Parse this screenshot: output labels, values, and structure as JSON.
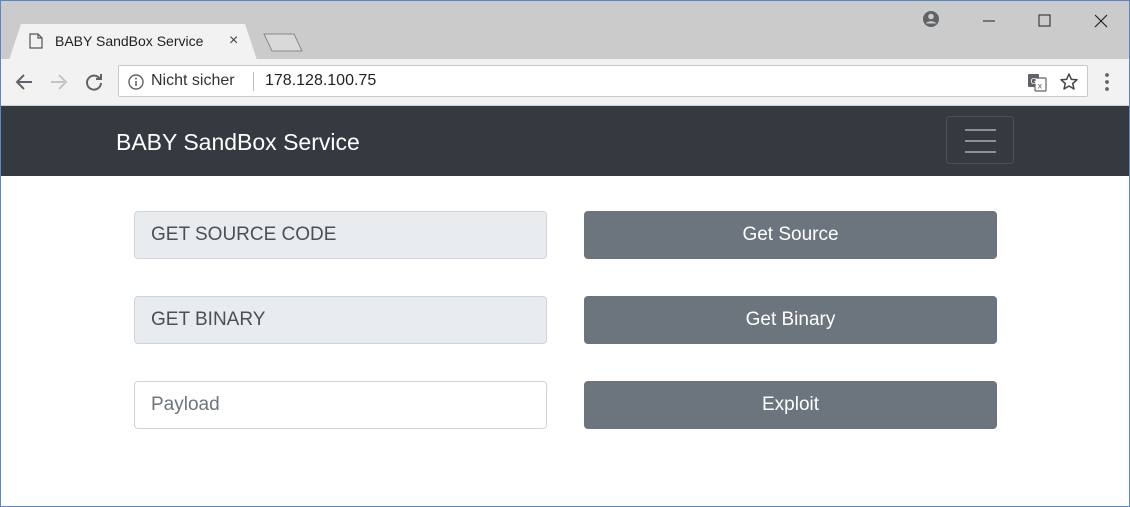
{
  "browser": {
    "tab_title": "BABY SandBox Service",
    "tab_close": "×",
    "security_label": "Nicht sicher",
    "url": "178.128.100.75"
  },
  "navbar": {
    "brand": "BABY SandBox Service"
  },
  "form": {
    "source_field_value": "GET SOURCE CODE",
    "source_button_label": "Get Source",
    "binary_field_value": "GET BINARY",
    "binary_button_label": "Get Binary",
    "payload_placeholder": "Payload",
    "exploit_button_label": "Exploit"
  },
  "colors": {
    "navbar_bg": "#343a40",
    "button_bg": "#6c757d",
    "readonly_bg": "#e9ecef"
  }
}
